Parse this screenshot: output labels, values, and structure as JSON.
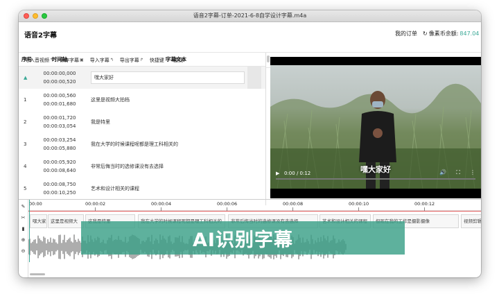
{
  "window": {
    "title": "语音2字幕-订单-2021-6-8自学设计字幕.m4a"
  },
  "header": {
    "app_title": "语音2字幕",
    "my_orders": "我的订单",
    "balance_label": "像素币余额:",
    "balance_value": "847.04"
  },
  "toolbar": {
    "items": [
      {
        "label": "导入音视频",
        "icon": "import-icon"
      },
      {
        "label": "保存字幕",
        "icon": "save-icon"
      },
      {
        "label": "导入字幕",
        "icon": "import-icon"
      },
      {
        "label": "导出字幕",
        "icon": "export-icon"
      },
      {
        "label": "快捷键",
        "icon": "help-icon"
      },
      {
        "label": "查找",
        "icon": "search-icon"
      }
    ]
  },
  "list": {
    "headers": [
      "序号",
      "时间轴",
      "字幕文本"
    ],
    "rows": [
      {
        "index": "",
        "start": "00:00:00,000",
        "end": "00:00:00,520",
        "text": "嘿大家好"
      },
      {
        "index": "1",
        "start": "00:00:00,560",
        "end": "00:00:01,680",
        "text": "这里是视频大拍档"
      },
      {
        "index": "2",
        "start": "00:00:01,720",
        "end": "00:00:03,054",
        "text": "我是特里"
      },
      {
        "index": "3",
        "start": "00:00:03,254",
        "end": "00:00:05,880",
        "text": "我在大学的时候课程呢都是理工科相关的"
      },
      {
        "index": "4",
        "start": "00:00:05,920",
        "end": "00:00:08,640",
        "text": "非常后悔当时的选修课没有去选择"
      },
      {
        "index": "5",
        "start": "00:00:08,750",
        "end": "00:00:10,250",
        "text": "艺术和设计相关的课程"
      }
    ]
  },
  "video": {
    "caption": "嘿大家好",
    "time": "0:00 / 0:12",
    "progress": 0.0
  },
  "timeline": {
    "ticks": [
      "00:00",
      "00:00:02",
      "00:00:04",
      "00:00:06",
      "00:00:08",
      "00:00:10",
      "00:00:12"
    ],
    "segments": [
      "嘿大家",
      "这里是视频大",
      "这我是特里",
      "我在大学的时候课程呢都是理工科相关的",
      "非常后悔当时的选修课没有去选择",
      "艺术和设计相关的课程",
      "但现在我的工作是摄影摄像",
      "视频剪辑"
    ]
  },
  "banner": {
    "text": "AI识别字幕"
  },
  "colors": {
    "accent": "#3aa896",
    "banner": "#3aa087",
    "playhead_line": "#e05a5a"
  }
}
